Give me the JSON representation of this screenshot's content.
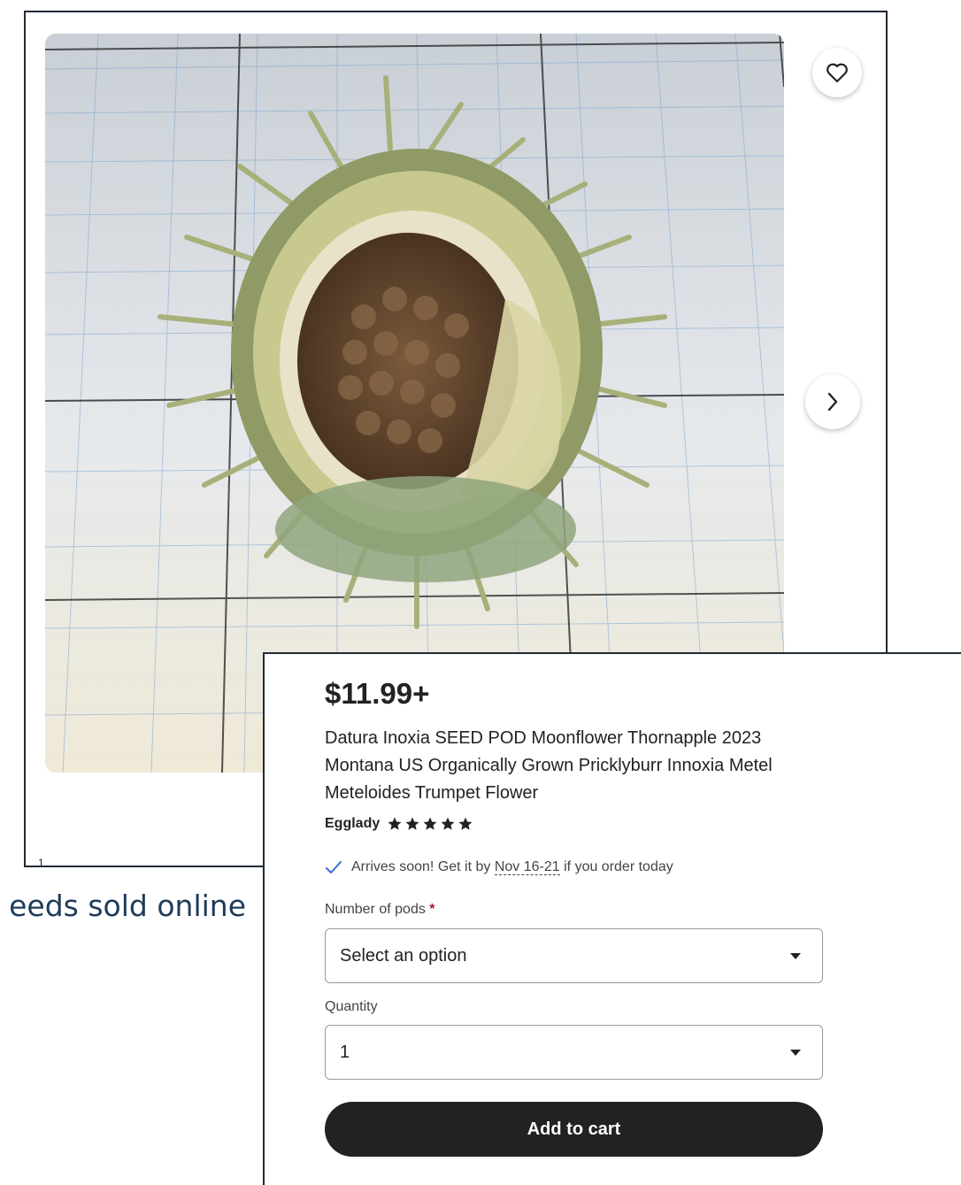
{
  "gallery": {
    "page_number": "1",
    "favorite_icon": "heart-outline-icon",
    "next_icon": "chevron-right-icon",
    "photo_alt": "Datura Inoxia seed pod on grid paper"
  },
  "caption": {
    "text": "eeds sold online"
  },
  "product": {
    "price": "$11.99+",
    "title": "Datura Inoxia SEED POD Moonflower Thornapple 2023 Montana US Organically Grown Pricklyburr Innoxia Metel Meteloides Trumpet Flower",
    "seller": "Egglady",
    "rating_stars": 5,
    "delivery": {
      "prefix": "Arrives soon! Get it by ",
      "date": "Nov 16-21",
      "suffix": " if you order today",
      "icon": "checkmark-icon"
    },
    "options": {
      "label": "Number of pods",
      "required_marker": "*",
      "selected": "Select an option"
    },
    "quantity": {
      "label": "Quantity",
      "selected": "1"
    },
    "add_to_cart": "Add to cart"
  },
  "colors": {
    "button_bg": "#222222",
    "required_star": "#a61a2e",
    "caption_text": "#1f3b5a"
  }
}
